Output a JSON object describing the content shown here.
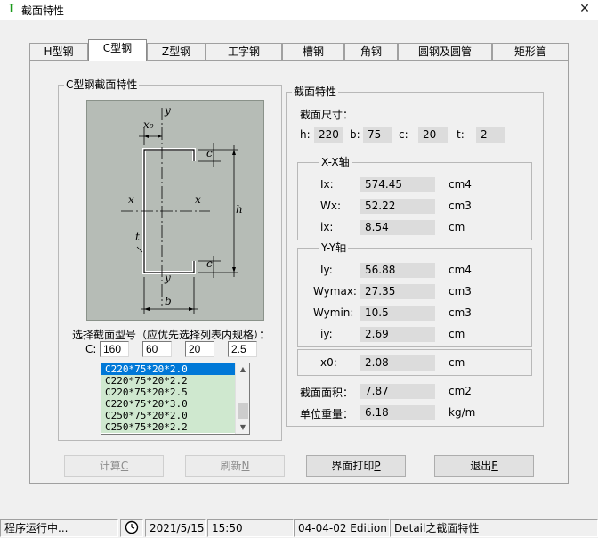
{
  "window": {
    "title": "截面特性",
    "close_glyph": "✕"
  },
  "tabs": [
    "H型钢",
    "C型钢",
    "Z型钢",
    "工字钢",
    "槽钢",
    "角钢",
    "圆钢及圆管",
    "矩形管"
  ],
  "left_group": {
    "title": "C型钢截面特性",
    "select_label": "选择截面型号（应优先选择列表内规格）：",
    "c_label": "C:",
    "inputs": [
      "160",
      "60",
      "20",
      "2.5"
    ],
    "list": [
      "C220*75*20*2.0",
      "C220*75*20*2.2",
      "C220*75*20*2.5",
      "C220*75*20*3.0",
      "C250*75*20*2.0",
      "C250*75*20*2.2"
    ],
    "selected_index": 0
  },
  "diagram": {
    "labels": {
      "x0": "x₀",
      "y_top": "y",
      "y_bottom": "y",
      "x_left": "x",
      "x_right": "x",
      "c_top": "c",
      "c_bottom": "c",
      "h": "h",
      "t": "t",
      "b": "b"
    }
  },
  "right_group": {
    "title": "截面特性",
    "size_title": "截面尺寸：",
    "dims": [
      {
        "label": "h:",
        "value": "220"
      },
      {
        "label": "b:",
        "value": "75"
      },
      {
        "label": "c:",
        "value": "20"
      },
      {
        "label": "t:",
        "value": "2"
      }
    ],
    "xx_title": "X-X轴",
    "xx": [
      {
        "label": "Ix:",
        "value": "574.45",
        "unit": "cm4"
      },
      {
        "label": "Wx:",
        "value": "52.22",
        "unit": "cm3"
      },
      {
        "label": "ix:",
        "value": "8.54",
        "unit": "cm"
      }
    ],
    "yy_title": "Y-Y轴",
    "yy": [
      {
        "label": "Iy:",
        "value": "56.88",
        "unit": "cm4"
      },
      {
        "label": "Wymax:",
        "value": "27.35",
        "unit": "cm3"
      },
      {
        "label": "Wymin:",
        "value": "10.5",
        "unit": "cm3"
      },
      {
        "label": "iy:",
        "value": "2.69",
        "unit": "cm"
      }
    ],
    "x0": {
      "label": "x0:",
      "value": "2.08",
      "unit": "cm"
    },
    "area": {
      "label": "截面面积：",
      "value": "7.87",
      "unit": "cm2"
    },
    "weight": {
      "label": "单位重量：",
      "value": "6.18",
      "unit": "kg/m"
    }
  },
  "buttons": {
    "calc": {
      "text": "计算",
      "key": "C"
    },
    "refresh": {
      "text": "刷新",
      "key": "N"
    },
    "print": {
      "text": "界面打印",
      "key": "P"
    },
    "exit": {
      "text": "退出",
      "key": "E"
    }
  },
  "status": {
    "message": "程序运行中...",
    "date": "2021/5/15",
    "time": "15:50",
    "edition": "04-04-02 Edition",
    "detail": "Detail之截面特性"
  },
  "colors": {
    "accent": "#0078d7",
    "list_bg": "#cfe8cf",
    "diagram_bg": "#b6bcb6",
    "icon_green": "#1a9a1a"
  }
}
